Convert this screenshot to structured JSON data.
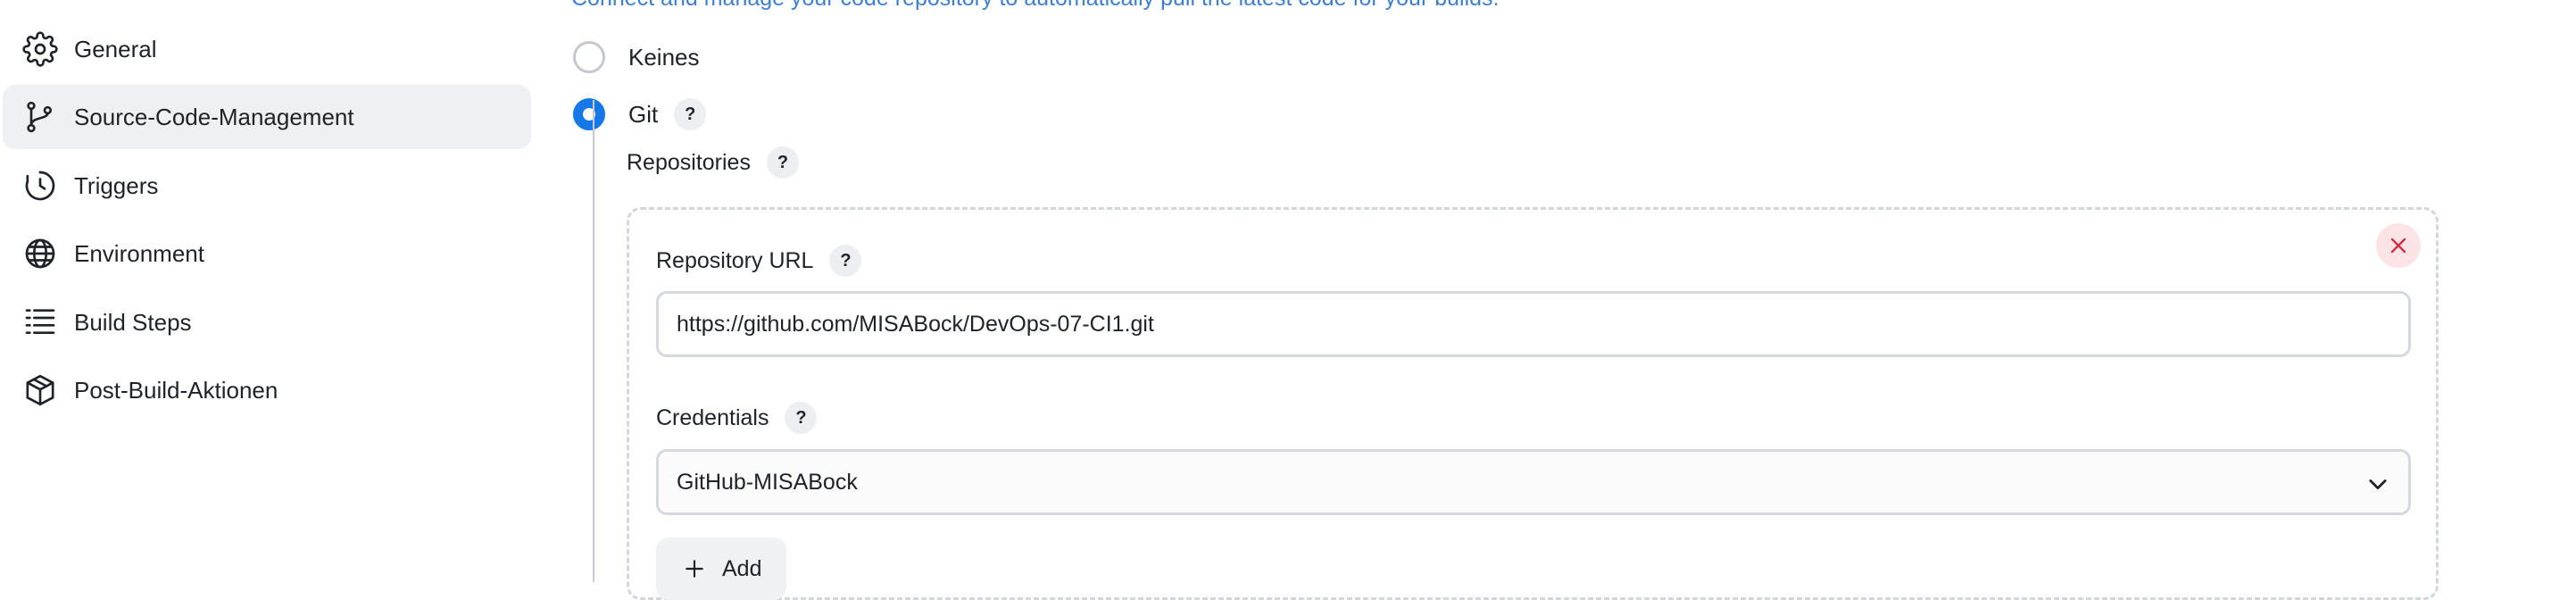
{
  "sidebar": {
    "items": [
      {
        "label": "General",
        "icon": "gear-icon"
      },
      {
        "label": "Source-Code-Management",
        "icon": "git-branch-icon",
        "active": true
      },
      {
        "label": "Triggers",
        "icon": "clock-icon"
      },
      {
        "label": "Environment",
        "icon": "globe-icon"
      },
      {
        "label": "Build Steps",
        "icon": "list-icon"
      },
      {
        "label": "Post-Build-Aktionen",
        "icon": "package-icon"
      }
    ]
  },
  "scm": {
    "description": "Connect and manage your code repository to automatically pull the latest code for your builds.",
    "options": [
      {
        "label": "Keines",
        "selected": false
      },
      {
        "label": "Git",
        "selected": true
      }
    ],
    "help_label": "?",
    "repositories_label": "Repositories",
    "repository": {
      "url_label": "Repository URL",
      "url_value": "https://github.com/MISABock/DevOps-07-CI1.git",
      "credentials_label": "Credentials",
      "credentials_value": "GitHub-MISABock",
      "add_label": "Add"
    }
  },
  "colors": {
    "accent": "#1677e6",
    "link": "#3d7fd1",
    "close_bg": "#fbe3e6",
    "close_fg": "#d12f45"
  }
}
